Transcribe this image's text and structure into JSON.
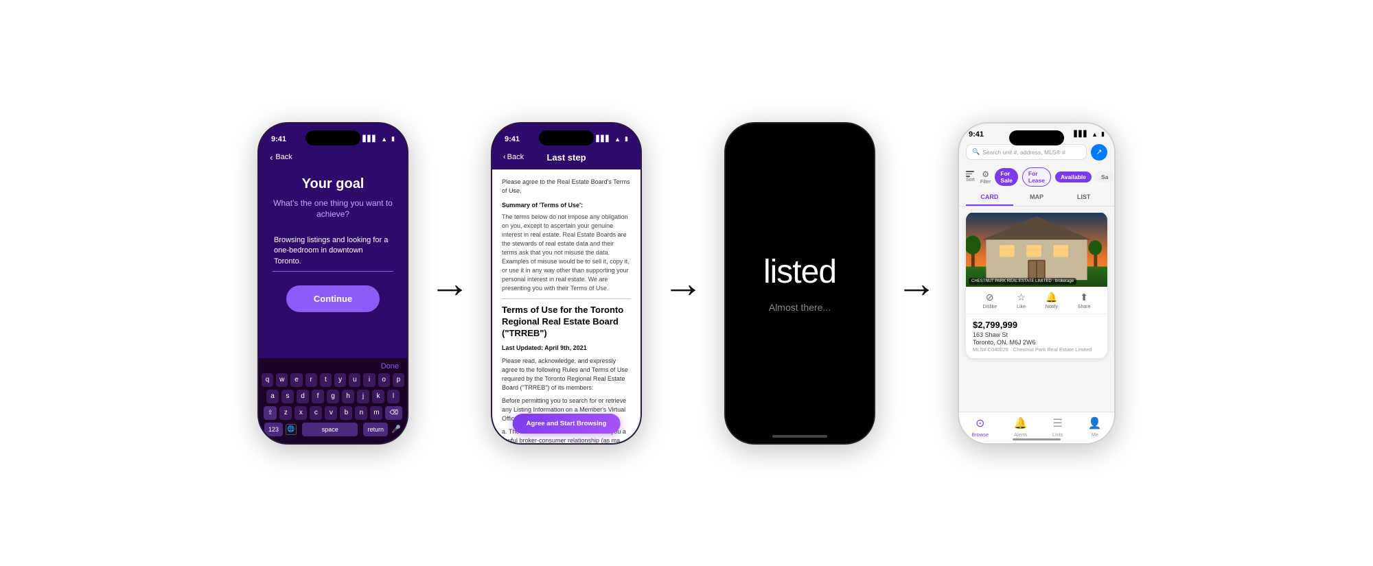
{
  "scene": {
    "background": "#ffffff"
  },
  "phone1": {
    "status_time": "9:41",
    "status_icons": "▲ ▼ ◼",
    "back_label": "Back",
    "goal_title": "Your goal",
    "goal_subtitle": "What's the one thing you want to achieve?",
    "goal_input_value": "Browsing listings and looking for a one-bedroom in downtown Toronto.",
    "continue_label": "Continue",
    "keyboard_done": "Done",
    "kb_row1": [
      "q",
      "w",
      "e",
      "r",
      "t",
      "y",
      "u",
      "i",
      "o",
      "p"
    ],
    "kb_row2": [
      "a",
      "s",
      "d",
      "f",
      "g",
      "h",
      "j",
      "k",
      "l"
    ],
    "kb_row3": [
      "z",
      "x",
      "c",
      "v",
      "b",
      "n",
      "m"
    ],
    "kb_123": "123",
    "kb_space": "space",
    "kb_return": "return"
  },
  "phone2": {
    "status_time": "9:41",
    "back_label": "Back",
    "header_title": "Last step",
    "intro": "Please agree to the Real Estate Board's Terms of Use.",
    "summary_title": "Summary of 'Terms of Use':",
    "summary_body": "The terms below do not impose any obligation on you, except to ascertain your genuine interest in real estate. Real Estate Boards are the stewards of real estate data and their terms ask that you not misuse the data. Examples of misuse would be to sell it, copy it, or use it in any way other than supporting your personal interest in real estate. We are presenting you with their Terms of Use.",
    "terms_main_title": "Terms of Use for the Toronto Regional Real Estate Board (\"TRREB\")",
    "last_updated": "Last Updated: April 9th, 2021",
    "terms_para1": "Please read, acknowledge, and expressly agree to the following Rules and Terms of Use required by the Toronto Regional Real Estate Board (\"TRREB\") of its members:",
    "terms_para2": "Before permitting you to search for or retrieve any Listing Information on a Member's Virtual Office Website",
    "terms_item_a": "a.  The Member must first establish with you a lawful broker-consumer relationship (as ma",
    "agree_btn_label": "Agree and Start Browsing"
  },
  "phone3": {
    "app_name": "listed",
    "loading_text": "Almost there..."
  },
  "phone4": {
    "status_time": "9:41",
    "search_placeholder": "Search unit #, address, MLS® #",
    "filter_label": "Filter",
    "sort_label": "Sort",
    "chip_sale": "For Sale",
    "chip_lease": "For Lease",
    "chip_available": "Available",
    "chip_more": "Sa",
    "tab_card": "CARD",
    "tab_map": "MAP",
    "tab_list": "LIST",
    "listing_price": "$2,799,999",
    "listing_street": "163 Shaw St",
    "listing_city": "Toronto, ON, M6J 2W6",
    "listing_agent": "MLS# C040026 · Chestnut Park Real Estate Limited",
    "action_dislike": "Dislike",
    "action_like": "Like",
    "action_notify": "Notify",
    "action_share": "Share",
    "tab_bar_browse": "Browse",
    "tab_bar_alerts": "Alerts",
    "tab_bar_lists": "Lists",
    "tab_bar_me": "Me",
    "listing_badge": "CHESTNUT PARK REAL ESTATE LIMITED  ·  brokerage"
  },
  "arrows": {
    "arrow1": "→",
    "arrow2": "→",
    "arrow3": "→"
  }
}
